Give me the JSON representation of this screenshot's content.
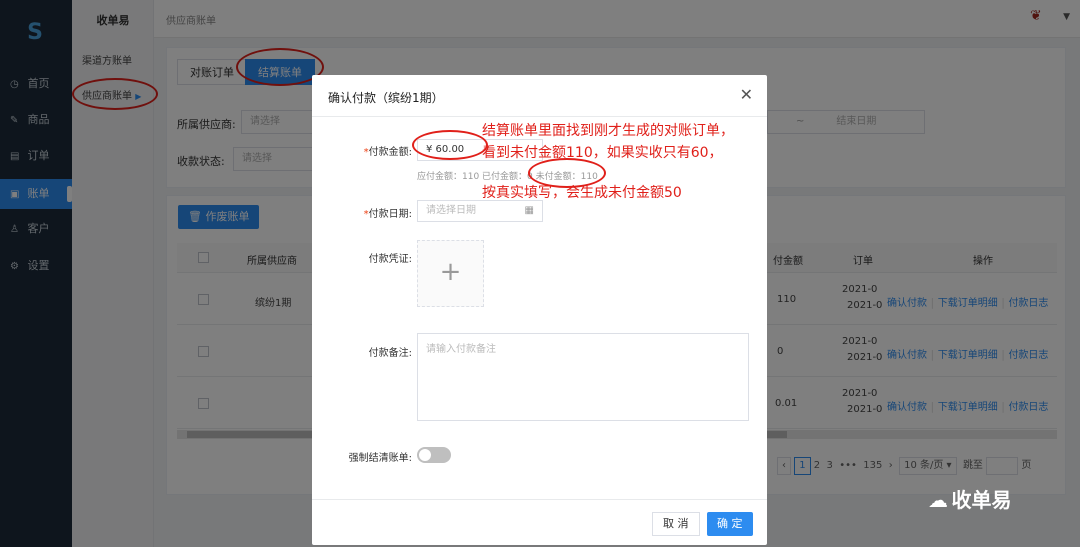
{
  "nav": {
    "items": [
      {
        "label": "首页",
        "icon": "clock-icon"
      },
      {
        "label": "商品",
        "icon": "edit-icon"
      },
      {
        "label": "订单",
        "icon": "list-icon"
      },
      {
        "label": "账单",
        "icon": "clipboard-icon"
      },
      {
        "label": "客户",
        "icon": "user-icon"
      },
      {
        "label": "设置",
        "icon": "gear-icon"
      }
    ],
    "active_index": 3
  },
  "sub": {
    "title": "收单易",
    "items": [
      "渠道方账单",
      "供应商账单"
    ]
  },
  "topbar": {
    "breadcrumb": "供应商账单"
  },
  "tabs": [
    "对账订单",
    "结算账单"
  ],
  "filters": {
    "supplier_label": "所属供应商:",
    "supplier_placeholder": "请选择",
    "status_label": "收款状态:",
    "status_placeholder": "请选择",
    "range_sep": "~",
    "end_date_placeholder": "结束日期"
  },
  "toolbar": {
    "void_button": "作废账单"
  },
  "table": {
    "headers": [
      "所属供应商",
      "付金额",
      "订单",
      "操作"
    ],
    "rows": [
      {
        "supplier": "缤纷1期",
        "amount": "110",
        "date1": "2021-0",
        "date2": "2021-0"
      },
      {
        "supplier": "",
        "amount": "0",
        "date1": "2021-0",
        "date2": "2021-0"
      },
      {
        "supplier": "",
        "amount": "0.01",
        "date1": "2021-0",
        "date2": "2021-0"
      }
    ],
    "actions": [
      "确认付款",
      "下载订单明细",
      "付款日志"
    ]
  },
  "pager": {
    "pages": [
      "1",
      "2",
      "3",
      "•••",
      "135"
    ],
    "size": "10 条/页",
    "jump_label": "跳至",
    "page_suffix": "页"
  },
  "dialog": {
    "title": "确认付款（缤纷1期）",
    "amount_label": "付款金额:",
    "amount_value": "¥ 60.00",
    "amount_hint": "应付金额：110 已付金额：0 未付金额：110",
    "date_label": "付款日期:",
    "date_placeholder": "请选择日期",
    "voucher_label": "付款凭证:",
    "remark_label": "付款备注:",
    "remark_placeholder": "请输入付款备注",
    "force_label": "强制结清账单:",
    "cancel": "取 消",
    "confirm": "确 定"
  },
  "annotation": {
    "lines": [
      "结算账单里面找到刚才生成的对账订单，",
      "看到未付金额110，如果实收只有60，",
      "按真实填写，会生成未付金额50"
    ],
    "color": "#e0201a"
  },
  "watermark": "收单易",
  "accent": "#2d8cf0"
}
